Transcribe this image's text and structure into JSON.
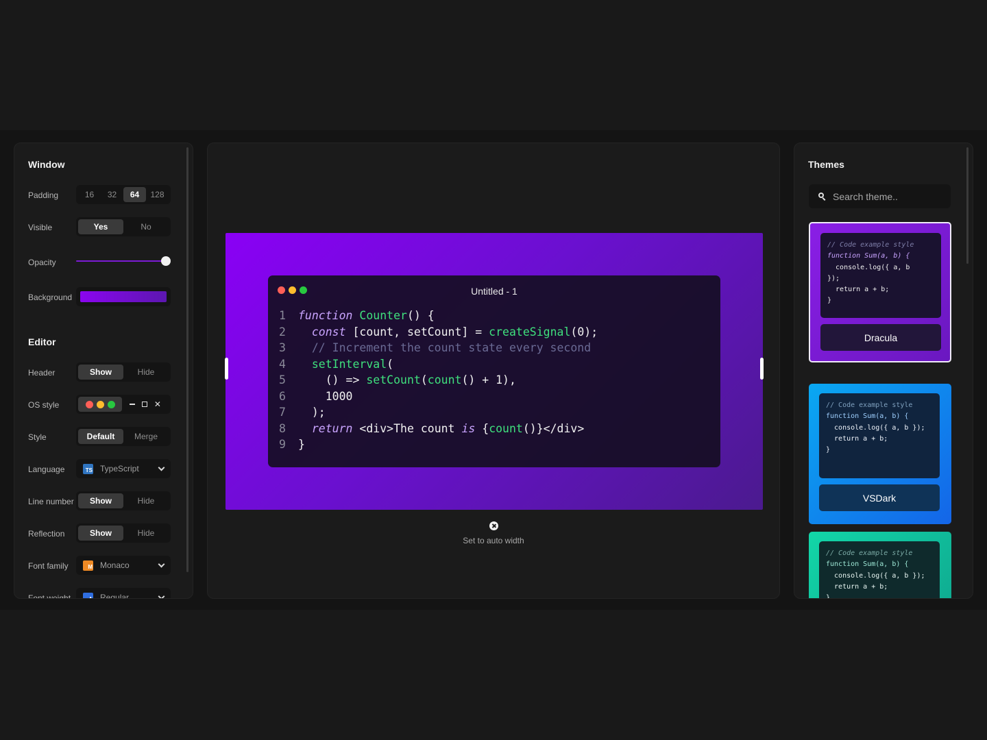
{
  "window_section": {
    "title": "Window",
    "padding": {
      "label": "Padding",
      "options": [
        "16",
        "32",
        "64",
        "128"
      ],
      "selected": "64"
    },
    "visible": {
      "label": "Visible",
      "options": [
        "Yes",
        "No"
      ],
      "selected": "Yes"
    },
    "opacity": {
      "label": "Opacity",
      "value": 1.0
    },
    "background": {
      "label": "Background",
      "color_from": "#8b05f0",
      "color_to": "#5c17b0"
    }
  },
  "editor_section": {
    "title": "Editor",
    "header": {
      "label": "Header",
      "options": [
        "Show",
        "Hide"
      ],
      "selected": "Show"
    },
    "os_style": {
      "label": "OS style",
      "options": [
        "mac",
        "windows"
      ],
      "selected": "mac",
      "icons": [
        "minimize-icon",
        "maximize-icon",
        "close-icon"
      ]
    },
    "style": {
      "label": "Style",
      "options": [
        "Default",
        "Merge"
      ],
      "selected": "Default"
    },
    "language": {
      "label": "Language",
      "value": "TypeScript",
      "badge": "TS",
      "badge_color": "#2f74c0"
    },
    "line_number": {
      "label": "Line number",
      "options": [
        "Show",
        "Hide"
      ],
      "selected": "Show"
    },
    "reflection": {
      "label": "Reflection",
      "options": [
        "Show",
        "Hide"
      ],
      "selected": "Show"
    },
    "font_family": {
      "label": "Font family",
      "value": "Monaco",
      "badge": "M",
      "badge_color": "#f08a24"
    },
    "font_weight": {
      "label": "Font weight",
      "value": "Regular",
      "badge": "A",
      "badge_color": "#2f6ee0"
    }
  },
  "preview": {
    "window_title": "Untitled - 1",
    "traffic_lights": [
      "#ff5f57",
      "#febc2e",
      "#28c840"
    ],
    "line_numbers": [
      "1",
      "2",
      "3",
      "4",
      "5",
      "6",
      "7",
      "8",
      "9"
    ],
    "code": {
      "l1_kw": "function",
      "l1_fn": "Counter",
      "l1_rest": "() {",
      "l2_kw": "const",
      "l2_a": " [count, setCount] = ",
      "l2_fn": "createSignal",
      "l2_b": "(0);",
      "l3_comment": "// Increment the count state every second",
      "l4_fn": "setInterval",
      "l4_b": "(",
      "l5_a": "() => ",
      "l5_fn": "setCount",
      "l5_b": "(",
      "l5_fn2": "count",
      "l5_c": "() + 1),",
      "l6": "1000",
      "l7": ");",
      "l8_kw": "return",
      "l8_a": " <div>The count ",
      "l8_kw2": "is",
      "l8_b": " {",
      "l8_fn": "count",
      "l8_c": "()}</div>",
      "l9": "}"
    },
    "auto_width_label": "Set to auto width"
  },
  "themes": {
    "title": "Themes",
    "search_placeholder": "Search theme..",
    "items": [
      {
        "name": "Dracula",
        "selected": true,
        "lines": [
          "// Code example style",
          "function Sum(a, b) {",
          "  console.log({ a, b",
          "});",
          "  return a + b;",
          "}"
        ]
      },
      {
        "name": "VSDark",
        "selected": false,
        "lines": [
          "// Code example style",
          "function Sum(a, b) {",
          "  console.log({ a, b });",
          "  return a + b;",
          "}"
        ]
      },
      {
        "name": "",
        "selected": false,
        "lines": [
          "// Code example style",
          "function Sum(a, b) {",
          "  console.log({ a, b });",
          "  return a + b;",
          "}"
        ]
      }
    ]
  }
}
